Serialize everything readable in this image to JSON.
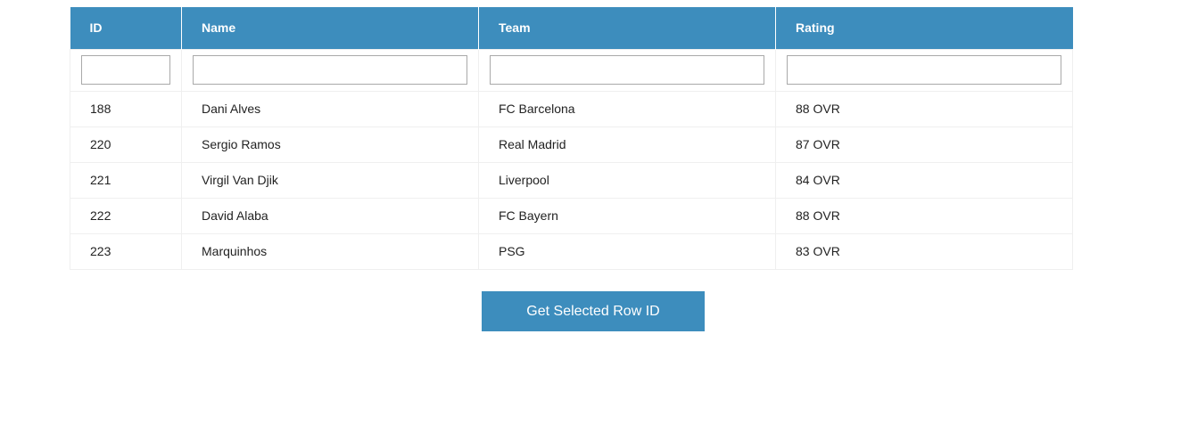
{
  "table": {
    "columns": [
      {
        "key": "id",
        "label": "ID",
        "filter_value": "",
        "filter_placeholder": ""
      },
      {
        "key": "name",
        "label": "Name",
        "filter_value": "",
        "filter_placeholder": ""
      },
      {
        "key": "team",
        "label": "Team",
        "filter_value": "",
        "filter_placeholder": ""
      },
      {
        "key": "rating",
        "label": "Rating",
        "filter_value": "",
        "filter_placeholder": ""
      }
    ],
    "rows": [
      {
        "id": "188",
        "name": "Dani Alves",
        "team": "FC Barcelona",
        "rating": "88 OVR"
      },
      {
        "id": "220",
        "name": "Sergio Ramos",
        "team": "Real Madrid",
        "rating": "87 OVR"
      },
      {
        "id": "221",
        "name": "Virgil Van Djik",
        "team": "Liverpool",
        "rating": "84 OVR"
      },
      {
        "id": "222",
        "name": "David Alaba",
        "team": "FC Bayern",
        "rating": "88 OVR"
      },
      {
        "id": "223",
        "name": "Marquinhos",
        "team": "PSG",
        "rating": "83 OVR"
      }
    ]
  },
  "actions": {
    "get_selected_label": "Get Selected Row ID"
  },
  "colors": {
    "header_bg": "#3d8dbd",
    "header_text": "#ffffff",
    "button_bg": "#3d8dbd",
    "row_border": "#efefef"
  }
}
